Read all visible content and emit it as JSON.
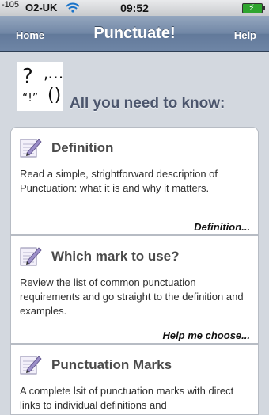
{
  "status_bar": {
    "signal": "-105",
    "carrier": "O2-UK",
    "time": "09:52"
  },
  "nav": {
    "home_label": "Home",
    "title": "Punctuate!",
    "help_label": "Help"
  },
  "logo": {
    "line1a": "?",
    "line1b": ",…",
    "line2a": "“!”",
    "line2b": "()"
  },
  "tagline": "All you need to know:",
  "cards": [
    {
      "title": "Definition",
      "description": "Read a simple, strightforward description of Punctuation: what it is and why it matters.",
      "link": "Definition..."
    },
    {
      "title": "Which mark to use?",
      "description": "Review the list of common punctuation requirements and go straight to the definition and examples.",
      "link": "Help me choose..."
    },
    {
      "title": "Punctuation Marks",
      "description": "A complete lsit of punctuation marks with direct links to individual definitions and"
    }
  ]
}
